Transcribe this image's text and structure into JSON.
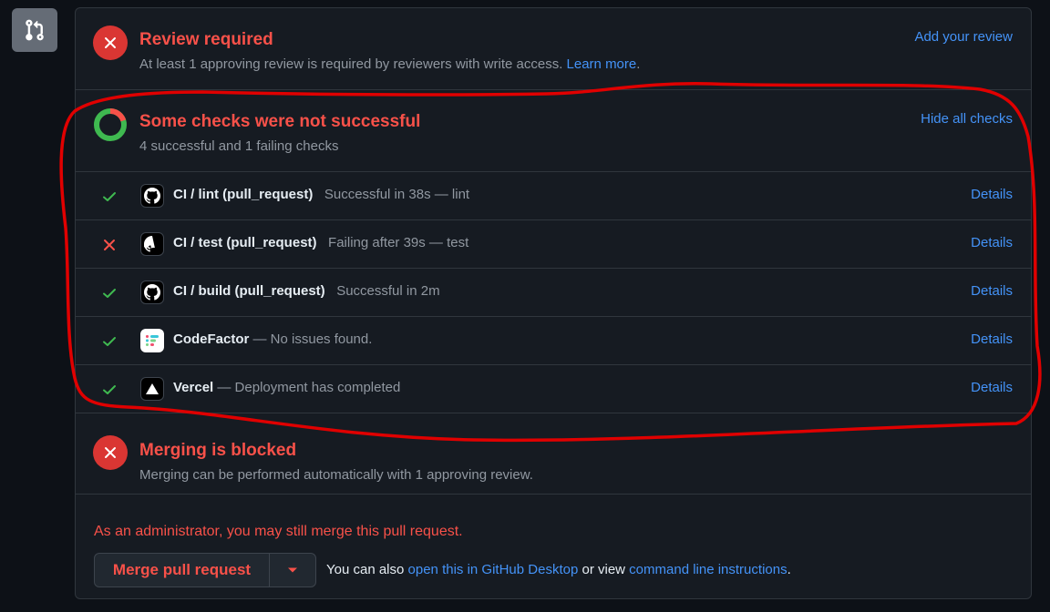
{
  "review": {
    "title": "Review required",
    "subtitle": "At least 1 approving review is required by reviewers with write access.",
    "learn_more": "Learn more",
    "period": ".",
    "action": "Add your review"
  },
  "checks": {
    "title": "Some checks were not successful",
    "subtitle": "4 successful and 1 failing checks",
    "action": "Hide all checks",
    "items": [
      {
        "name": "CI / lint (pull_request)",
        "desc": "Successful in 38s — lint",
        "status": "success",
        "app": "github-icon",
        "details": "Details"
      },
      {
        "name": "CI / test (pull_request)",
        "desc": "Failing after 39s — test",
        "status": "failure",
        "app": "github-icon",
        "details": "Details"
      },
      {
        "name": "CI / build (pull_request)",
        "desc": "Successful in 2m",
        "status": "success",
        "app": "github-icon",
        "details": "Details"
      },
      {
        "name": "CodeFactor",
        "desc": "— No issues found.",
        "status": "success",
        "app": "codefactor-icon",
        "details": "Details"
      },
      {
        "name": "Vercel",
        "desc": "— Deployment has completed",
        "status": "success",
        "app": "vercel-icon",
        "details": "Details"
      }
    ]
  },
  "blocked": {
    "title": "Merging is blocked",
    "subtitle": "Merging can be performed automatically with 1 approving review."
  },
  "merge": {
    "admin_note": "As an administrator, you may still merge this pull request.",
    "button": "Merge pull request",
    "also_prefix": "You can also",
    "desktop_link": "open this in GitHub Desktop",
    "also_middle": "or view",
    "cli_link": "command line instructions",
    "period": "."
  },
  "colors": {
    "danger": "#f85149",
    "success": "#3fb950",
    "link": "#4493f8",
    "annotation": "#e00000"
  }
}
